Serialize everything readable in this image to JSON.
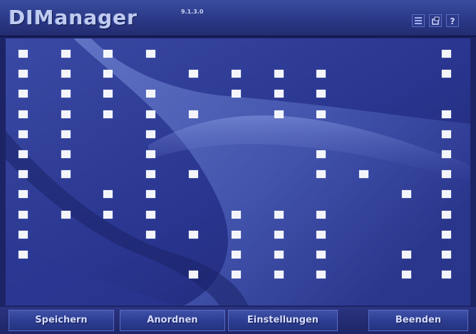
{
  "titlebar": {
    "title": "DIManager",
    "version": "9.1.3.0",
    "buttons": [
      "menu-icon",
      "restore-icon",
      "help-icon"
    ]
  },
  "desktop": {
    "slots": [
      [
        1,
        1,
        1,
        1,
        0,
        0,
        0,
        0,
        0,
        0,
        1
      ],
      [
        1,
        1,
        1,
        0,
        1,
        1,
        1,
        1,
        0,
        0,
        1
      ],
      [
        1,
        1,
        1,
        1,
        0,
        1,
        1,
        1,
        0,
        0,
        0
      ],
      [
        1,
        1,
        1,
        1,
        1,
        0,
        1,
        1,
        0,
        0,
        1
      ],
      [
        1,
        1,
        0,
        1,
        0,
        0,
        0,
        0,
        0,
        0,
        1
      ],
      [
        1,
        1,
        0,
        1,
        0,
        0,
        0,
        1,
        0,
        0,
        1
      ],
      [
        1,
        1,
        0,
        1,
        1,
        0,
        0,
        1,
        1,
        0,
        1
      ],
      [
        1,
        0,
        1,
        1,
        0,
        0,
        0,
        0,
        0,
        1,
        1
      ],
      [
        1,
        1,
        1,
        1,
        0,
        1,
        1,
        1,
        0,
        0,
        1
      ],
      [
        1,
        0,
        0,
        1,
        1,
        1,
        1,
        1,
        0,
        0,
        1
      ],
      [
        1,
        0,
        0,
        0,
        0,
        1,
        1,
        1,
        0,
        1,
        1
      ],
      [
        0,
        0,
        0,
        0,
        1,
        1,
        1,
        1,
        0,
        1,
        1
      ]
    ]
  },
  "bottombar": {
    "speichern": "Speichern",
    "anordnen": "Anordnen",
    "einstellungen": "Einstellungen",
    "beenden": "Beenden"
  }
}
